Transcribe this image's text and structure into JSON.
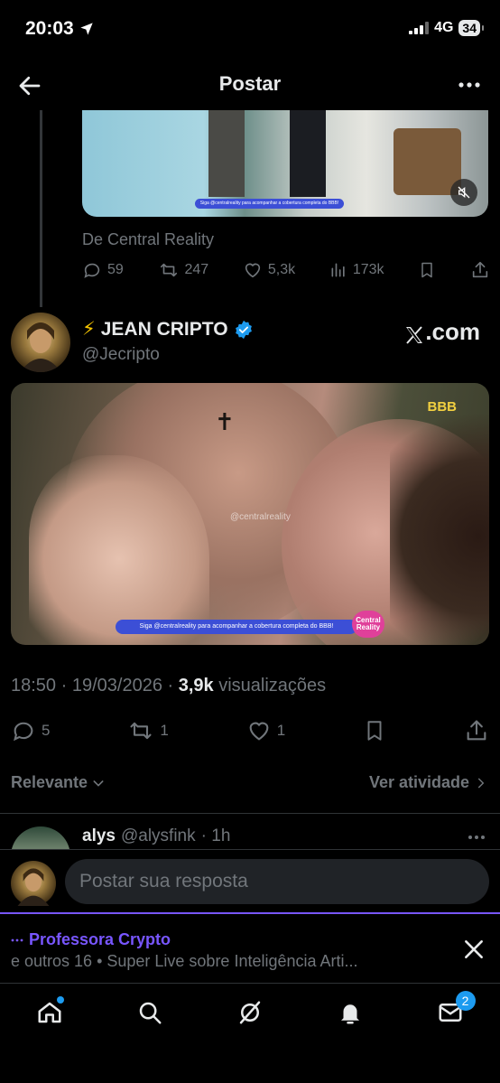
{
  "status_bar": {
    "time": "20:03",
    "network": "4G",
    "battery": "34"
  },
  "header": {
    "title": "Postar"
  },
  "quoted_post": {
    "banner_text": "Siga @centralreality para acompanhar a cobertura completa do BBB!",
    "badge_text": "Central Reality",
    "source_credit": "De Central Reality",
    "stats": {
      "replies": "59",
      "reposts": "247",
      "likes": "5,3k",
      "views": "173k"
    }
  },
  "author": {
    "display_name": "JEAN CRIPTO",
    "emoji": "⚡",
    "handle": "@Jecripto",
    "verified_color": "#1d9bf0",
    "site_label": ".com"
  },
  "media": {
    "logo_text": "BBB",
    "watermark": "@centralreality",
    "banner_text": "Siga @centralreality para acompanhar a cobertura completa do BBB!",
    "badge_text": "Central Reality"
  },
  "meta": {
    "time": "18:50",
    "date": "19/03/2026",
    "views_count": "3,9k",
    "views_label": "visualizações"
  },
  "actions": {
    "replies": "5",
    "reposts": "1",
    "likes": "1"
  },
  "filters": {
    "sort_label": "Relevante",
    "activity_label": "Ver atividade"
  },
  "reply_preview": {
    "name": "alys",
    "handle": "@alysfink",
    "time": "· 1h"
  },
  "composer": {
    "placeholder": "Postar sua resposta"
  },
  "spaces": {
    "host": "Professora Crypto",
    "description": "e outros 16 • Super Live sobre Inteligência Arti..."
  },
  "nav": {
    "messages_badge": "2"
  },
  "colors": {
    "accent": "#1d9bf0",
    "spaces": "#7856ff",
    "muted": "#71767b",
    "text": "#e7e9ea"
  }
}
